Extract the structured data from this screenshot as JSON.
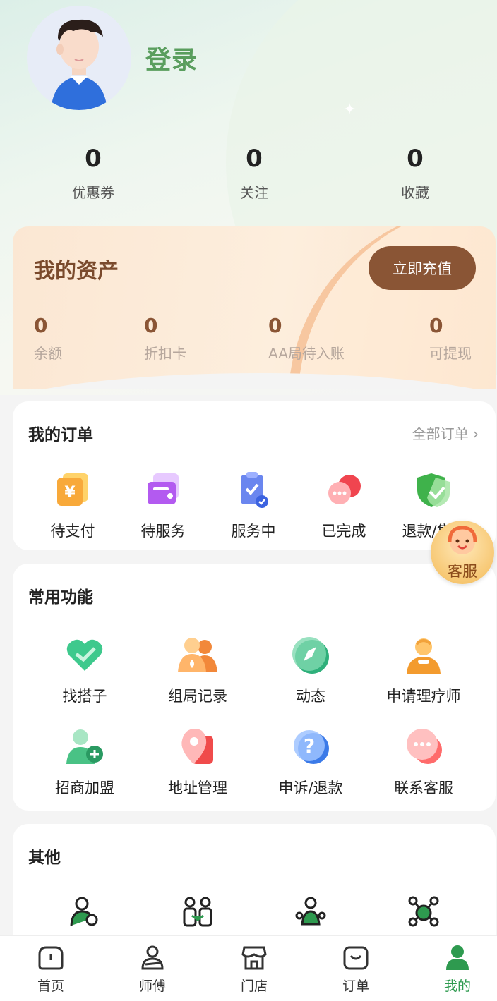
{
  "profile": {
    "login_label": "登录"
  },
  "stats": [
    {
      "value": "0",
      "label": "优惠券"
    },
    {
      "value": "0",
      "label": "关注"
    },
    {
      "value": "0",
      "label": "收藏"
    }
  ],
  "assets": {
    "title": "我的资产",
    "recharge_label": "立即充值",
    "items": [
      {
        "value": "0",
        "label": "余额"
      },
      {
        "value": "0",
        "label": "折扣卡"
      },
      {
        "value": "0",
        "label": "AA局待入账"
      },
      {
        "value": "0",
        "label": "可提现"
      }
    ]
  },
  "orders": {
    "title": "我的订单",
    "all_label": "全部订单",
    "items": [
      {
        "label": "待支付",
        "icon": "yuan-wallet-icon"
      },
      {
        "label": "待服务",
        "icon": "card-icon"
      },
      {
        "label": "服务中",
        "icon": "clipboard-check-icon"
      },
      {
        "label": "已完成",
        "icon": "chat-bubble-icon"
      },
      {
        "label": "退款/售后",
        "icon": "shield-check-icon"
      }
    ]
  },
  "common": {
    "title": "常用功能",
    "items": [
      {
        "label": "找搭子",
        "icon": "heart-icon"
      },
      {
        "label": "组局记录",
        "icon": "group-users-icon"
      },
      {
        "label": "动态",
        "icon": "compass-icon"
      },
      {
        "label": "申请理疗师",
        "icon": "therapist-icon"
      },
      {
        "label": "招商加盟",
        "icon": "add-user-icon"
      },
      {
        "label": "地址管理",
        "icon": "location-pin-icon"
      },
      {
        "label": "申诉/退款",
        "icon": "question-bubble-icon"
      },
      {
        "label": "联系客服",
        "icon": "message-icon"
      }
    ]
  },
  "other": {
    "title": "其他",
    "items": [
      {
        "icon": "agent-icon"
      },
      {
        "icon": "partners-icon"
      },
      {
        "icon": "team-icon"
      },
      {
        "icon": "network-icon"
      }
    ]
  },
  "floating_service": {
    "label": "客服"
  },
  "tabbar": [
    {
      "label": "首页",
      "icon": "home-icon",
      "active": false
    },
    {
      "label": "师傅",
      "icon": "master-icon",
      "active": false
    },
    {
      "label": "门店",
      "icon": "store-icon",
      "active": false
    },
    {
      "label": "订单",
      "icon": "order-bag-icon",
      "active": false
    },
    {
      "label": "我的",
      "icon": "profile-icon",
      "active": true
    }
  ],
  "colors": {
    "brand_green": "#2e9a4f",
    "login_green": "#5a9e5e",
    "asset_brown": "#8a5535"
  }
}
